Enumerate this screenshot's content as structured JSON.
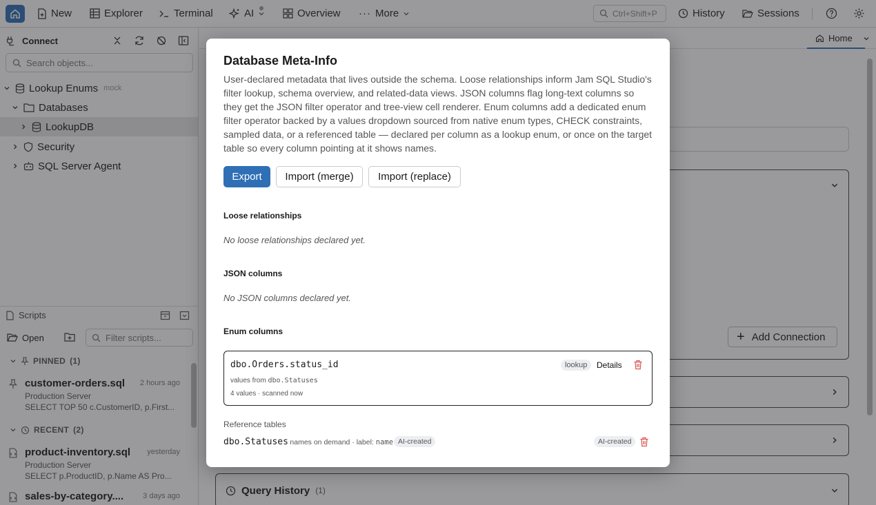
{
  "topbar": {
    "new": "New",
    "explorer": "Explorer",
    "terminal": "Terminal",
    "ai": "AI",
    "overview": "Overview",
    "more": "More",
    "search_shortcut": "Ctrl+Shift+P",
    "history": "History",
    "sessions": "Sessions"
  },
  "sidebar": {
    "connect": "Connect",
    "search_placeholder": "Search objects...",
    "tree": {
      "connection": "Lookup Enums",
      "connection_tag": "mock",
      "databases": "Databases",
      "database": "LookupDB",
      "security": "Security",
      "agent": "SQL Server Agent"
    },
    "scripts": {
      "title": "Scripts",
      "open": "Open",
      "filter_placeholder": "Filter scripts...",
      "pinned_label": "PINNED",
      "pinned_count": "(1)",
      "recent_label": "RECENT",
      "recent_count": "(2)",
      "items": [
        {
          "name": "customer-orders.sql",
          "time": "2 hours ago",
          "server": "Production Server",
          "preview": "SELECT TOP 50 c.CustomerID, p.First..."
        },
        {
          "name": "product-inventory.sql",
          "time": "yesterday",
          "server": "Production Server",
          "preview": "SELECT p.ProductID, p.Name AS Pro..."
        },
        {
          "name": "sales-by-category....",
          "time": "3 days ago"
        }
      ]
    }
  },
  "main": {
    "home_tab": "Home",
    "add_connection": "Add Connection",
    "query_history": "Query History",
    "query_history_count": "(1)"
  },
  "modal": {
    "title": "Database Meta-Info",
    "description": "User-declared metadata that lives outside the schema. Loose relationships inform Jam SQL Studio's filter lookup, schema overview, and related-data views. JSON columns flag long-text columns so they get the JSON filter operator and tree-view cell renderer. Enum columns add a dedicated enum filter operator backed by a values dropdown sourced from native enum types, CHECK constraints, sampled data, or a referenced table — declared per column as a lookup enum, or once on the target table so every column pointing at it shows names.",
    "export": "Export",
    "import_merge": "Import (merge)",
    "import_replace": "Import (replace)",
    "loose_title": "Loose relationships",
    "loose_empty": "No loose relationships declared yet.",
    "json_title": "JSON columns",
    "json_empty": "No JSON columns declared yet.",
    "enum_title": "Enum columns",
    "enum_item": {
      "column": "dbo.Orders.status_id",
      "badge": "lookup",
      "details": "Details",
      "values_from_label": "values from",
      "values_from_table": "dbo.Statuses",
      "stats": "4 values · scanned now"
    },
    "ref_title": "Reference tables",
    "ref_item": {
      "table": "dbo.Statuses",
      "meta_prefix": "· names on demand · label:",
      "label_col": "name",
      "inline_badge": "AI-created",
      "right_badge": "AI-created"
    }
  },
  "colors": {
    "accent": "#2f6fb5",
    "danger": "#d9534f"
  }
}
